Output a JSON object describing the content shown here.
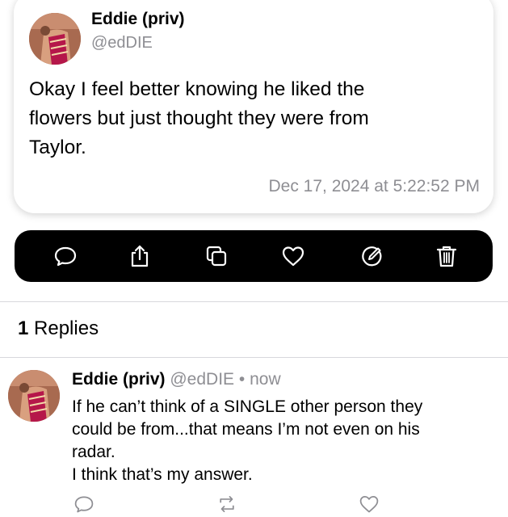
{
  "post": {
    "author_name": "Eddie (priv)",
    "author_handle": "@edDIE",
    "text_lines": [
      "Okay I feel better knowing he liked the",
      "flowers but just thought they were from",
      "Taylor."
    ],
    "timestamp": "Dec 17, 2024 at 5:22:52 PM"
  },
  "action_bar": {
    "background": "#000000",
    "icons": [
      "comment-icon",
      "share-icon",
      "copy-icon",
      "heart-icon",
      "edit-icon",
      "trash-icon"
    ]
  },
  "replies": {
    "count": "1",
    "label": "Replies"
  },
  "reply": {
    "author_name": "Eddie (priv)",
    "author_handle": "@edDIE",
    "separator": "•",
    "time": "now",
    "text_lines": [
      "If he can’t think of a SINGLE other person they",
      "could be from...that means I’m not even on his",
      "radar.",
      "I think that’s my answer."
    ],
    "actions": [
      "comment-icon",
      "repost-icon",
      "heart-icon"
    ]
  },
  "colors": {
    "secondary_text": "#8e8e93",
    "divider": "#d8d8dc"
  }
}
